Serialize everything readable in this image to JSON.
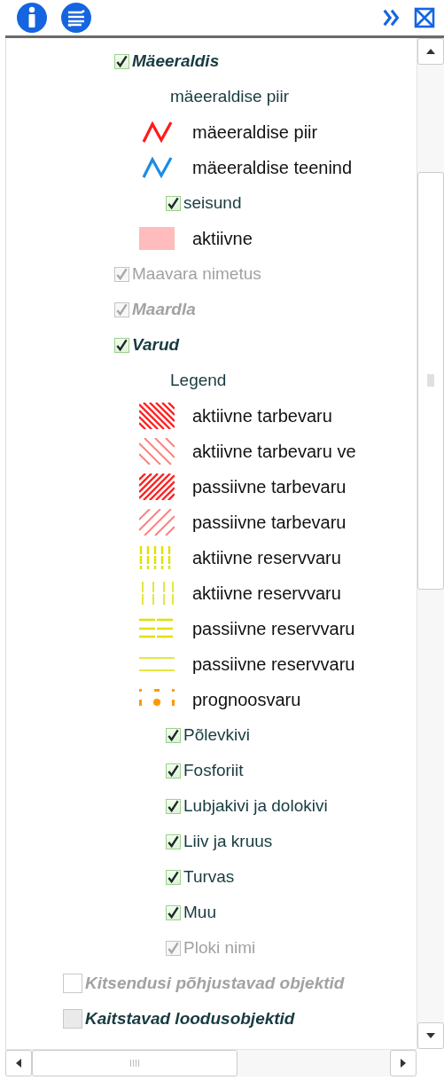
{
  "tree": {
    "nested_layers": [
      {
        "kind": "group",
        "label": "Mäeeraldis",
        "checked": true,
        "disabled": false,
        "children": [
          {
            "kind": "heading",
            "label": "mäeeraldise piir"
          },
          {
            "kind": "legend",
            "symbol": {
              "kind": "zigzag",
              "color": "#ff1a1a"
            },
            "label": "mäeeraldise piir"
          },
          {
            "kind": "legend",
            "symbol": {
              "kind": "zigzag",
              "color": "#1a8ce6"
            },
            "label": "mäeeraldise teenind"
          },
          {
            "kind": "layer",
            "label": "seisund",
            "checked": true,
            "disabled": false
          },
          {
            "kind": "legend",
            "symbol": {
              "kind": "fill",
              "color": "#ffbcbc"
            },
            "label": "aktiivne"
          }
        ]
      },
      {
        "kind": "layer",
        "label": "Maavara nimetus",
        "checked": true,
        "disabled": true
      },
      {
        "kind": "group",
        "label": "Maardla",
        "checked": true,
        "disabled": true
      },
      {
        "kind": "group",
        "label": "Varud",
        "checked": true,
        "disabled": false,
        "children": [
          {
            "kind": "heading",
            "label": "Legend"
          },
          {
            "kind": "legend",
            "symbol": {
              "kind": "backhatch",
              "dense": true,
              "color": "#ff2020"
            },
            "label": "aktiivne tarbevaru"
          },
          {
            "kind": "legend",
            "symbol": {
              "kind": "backhatch",
              "dense": false,
              "color": "#ff8080"
            },
            "label": "aktiivne tarbevaru ve"
          },
          {
            "kind": "legend",
            "symbol": {
              "kind": "forehatch",
              "dense": true,
              "color": "#ff2020"
            },
            "label": "passiivne tarbevaru"
          },
          {
            "kind": "legend",
            "symbol": {
              "kind": "forehatch",
              "dense": false,
              "color": "#ff8080"
            },
            "label": "passiivne tarbevaru"
          },
          {
            "kind": "legend",
            "symbol": {
              "kind": "vlines",
              "dense": true,
              "color": "#e0e000"
            },
            "label": "aktiivne reservvaru"
          },
          {
            "kind": "legend",
            "symbol": {
              "kind": "vlines",
              "dense": false,
              "color": "#e6e640"
            },
            "label": "aktiivne reservvaru"
          },
          {
            "kind": "legend",
            "symbol": {
              "kind": "hlines",
              "dense": true,
              "color": "#e0e000"
            },
            "label": "passiivne reservvaru"
          },
          {
            "kind": "legend",
            "symbol": {
              "kind": "hlines",
              "dense": false,
              "color": "#e6e640"
            },
            "label": "passiivne reservvaru"
          },
          {
            "kind": "legend",
            "symbol": {
              "kind": "dots",
              "color": "#ff9900"
            },
            "label": "prognoosvaru"
          },
          {
            "kind": "layer",
            "label": "Põlevkivi",
            "checked": true,
            "disabled": false
          },
          {
            "kind": "layer",
            "label": "Fosforiit",
            "checked": true,
            "disabled": false
          },
          {
            "kind": "layer",
            "label": "Lubjakivi ja dolokivi",
            "checked": true,
            "disabled": false
          },
          {
            "kind": "layer",
            "label": "Liiv ja kruus",
            "checked": true,
            "disabled": false
          },
          {
            "kind": "layer",
            "label": "Turvas",
            "checked": true,
            "disabled": false
          },
          {
            "kind": "layer",
            "label": "Muu",
            "checked": true,
            "disabled": false
          },
          {
            "kind": "layer",
            "label": "Ploki nimi",
            "checked": true,
            "disabled": true
          }
        ]
      }
    ],
    "layers": [
      {
        "kind": "group",
        "label": "Kitsendusi põhjustavad objektid",
        "checked": false,
        "disabled": true
      },
      {
        "kind": "group",
        "label": "Kaitstavad loodusobjektid",
        "checked": false,
        "disabled": false
      }
    ]
  }
}
